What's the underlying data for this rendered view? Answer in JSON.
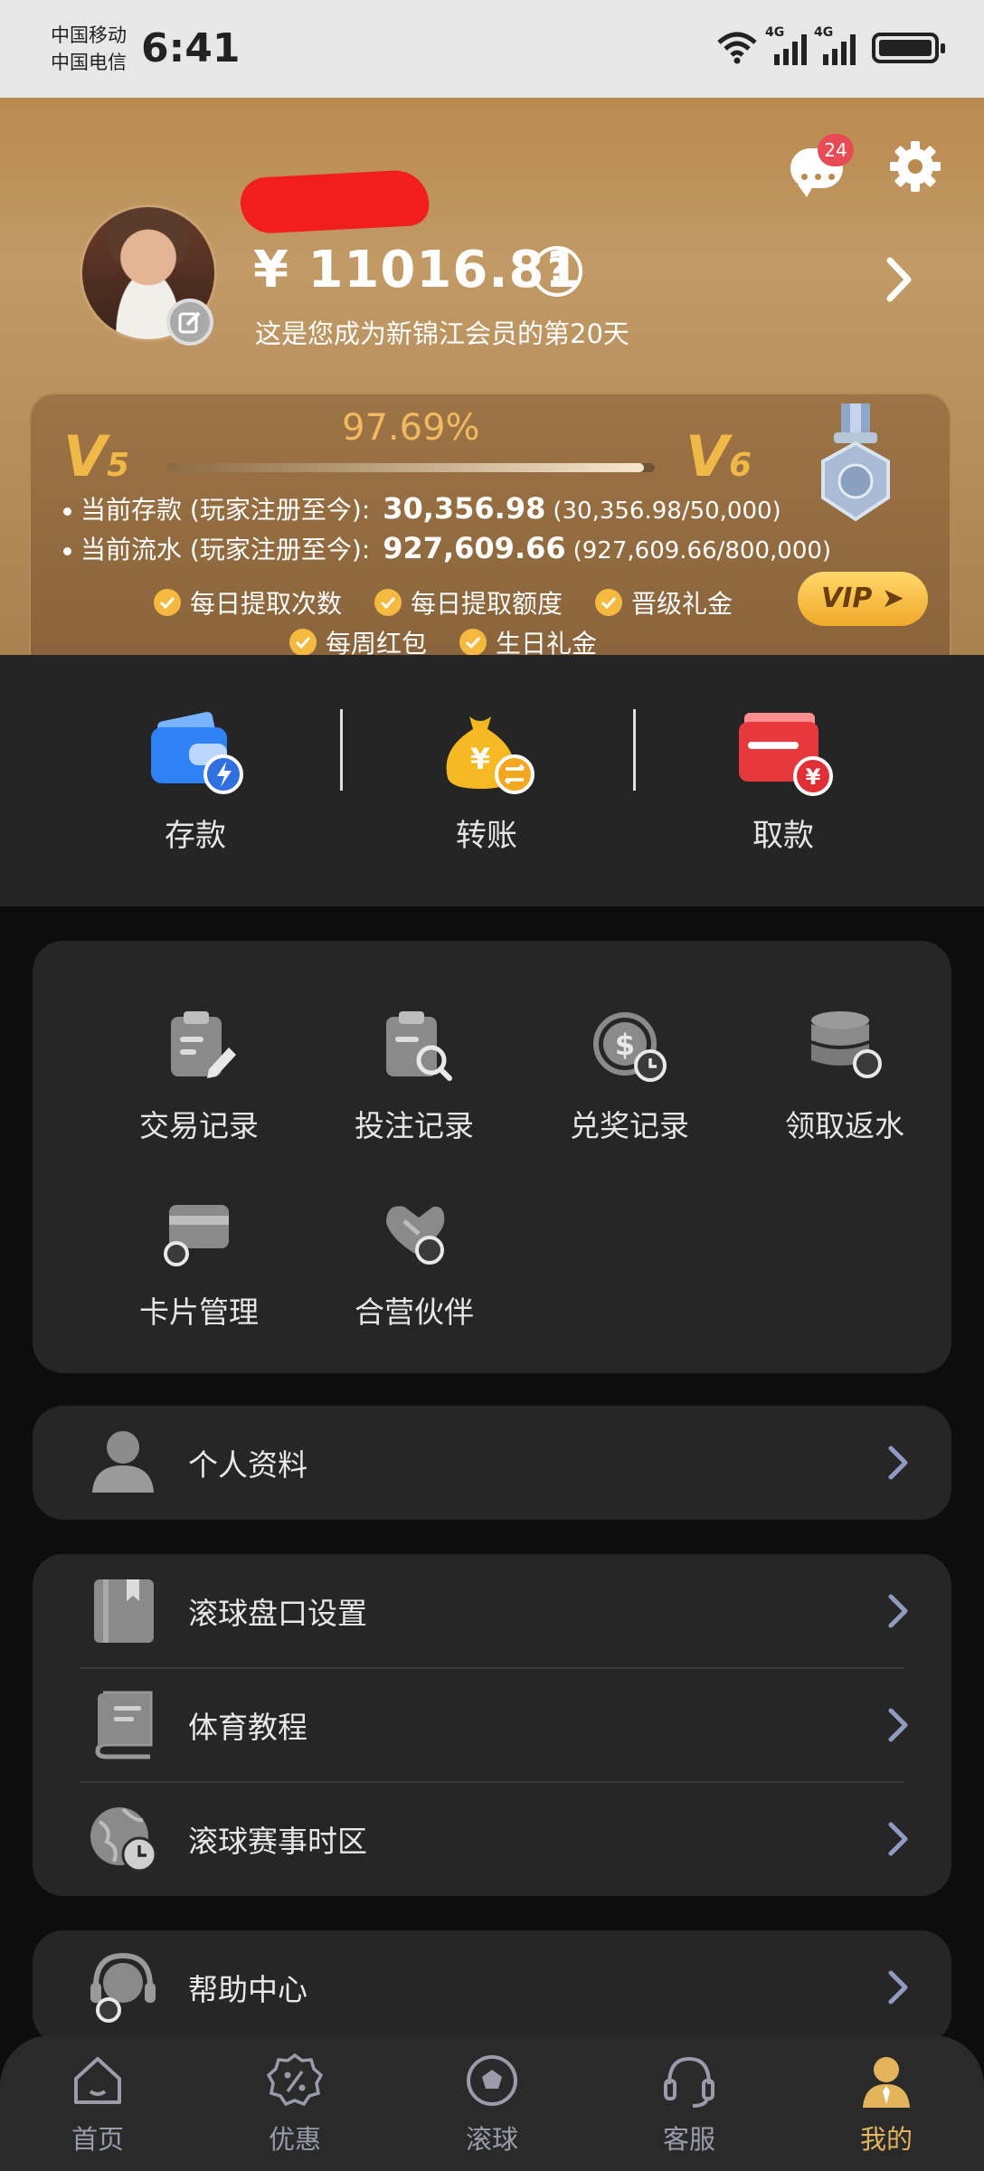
{
  "status_bar": {
    "carrier_1": "中国移动",
    "carrier_2": "中国电信",
    "time": "6:41",
    "network_1": "4G",
    "network_2": "4G"
  },
  "header": {
    "message_badge": "24",
    "balance": "¥ 11016.81",
    "help_symbol": "?",
    "member_days": "这是您成为新锦江会员的第20天"
  },
  "vip": {
    "current_level_letter": "V",
    "current_level_num": "5",
    "next_level_letter": "V",
    "next_level_num": "6",
    "progress_text": "97.69%",
    "progress_percent": 97.69,
    "deposit_label": "当前存款 (玩家注册至今):",
    "deposit_value": "30,356.98",
    "deposit_detail": "(30,356.98/50,000)",
    "turnover_label": "当前流水 (玩家注册至今):",
    "turnover_value": "927,609.66",
    "turnover_detail": "(927,609.66/800,000)",
    "benefits": [
      "每日提取次数",
      "每日提取额度",
      "晋级礼金",
      "每周红包",
      "生日礼金"
    ],
    "vip_button": "VIP ➤"
  },
  "money_actions": [
    {
      "label": "存款",
      "icon": "wallet-lightning-icon"
    },
    {
      "label": "转账",
      "icon": "money-bag-transfer-icon"
    },
    {
      "label": "取款",
      "icon": "card-withdraw-icon"
    }
  ],
  "grid": [
    {
      "label": "交易记录",
      "icon": "clipboard-edit-icon"
    },
    {
      "label": "投注记录",
      "icon": "clipboard-search-icon"
    },
    {
      "label": "兑奖记录",
      "icon": "dollar-clock-icon"
    },
    {
      "label": "领取返水",
      "icon": "database-icon"
    },
    {
      "label": "卡片管理",
      "icon": "card-icon"
    },
    {
      "label": "合营伙伴",
      "icon": "handshake-icon"
    }
  ],
  "profile_row": {
    "label": "个人资料"
  },
  "settings_rows": [
    {
      "label": "滚球盘口设置"
    },
    {
      "label": "体育教程"
    },
    {
      "label": "滚球赛事时区"
    }
  ],
  "help_row": {
    "label": "帮助中心"
  },
  "tabbar": [
    {
      "label": "首页",
      "active": false
    },
    {
      "label": "优惠",
      "active": false
    },
    {
      "label": "滚球",
      "active": false
    },
    {
      "label": "客服",
      "active": false
    },
    {
      "label": "我的",
      "active": true
    }
  ],
  "colors": {
    "gold_header": "#b98a50",
    "accent_gold": "#f0b947",
    "badge_red": "#e74b55",
    "card_bg": "#262627",
    "page_bg": "#0d0d0d",
    "active_tab": "#e3b45c"
  }
}
